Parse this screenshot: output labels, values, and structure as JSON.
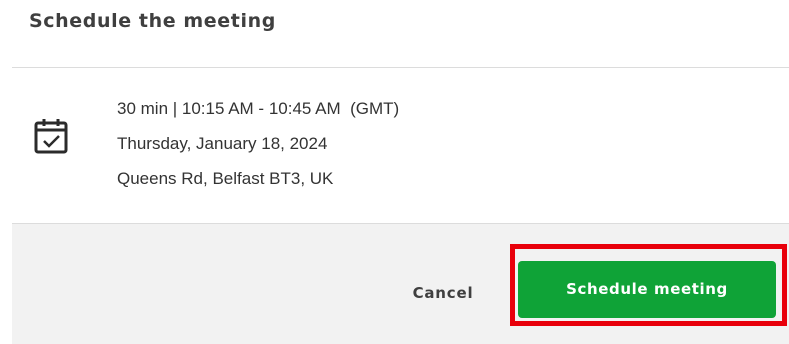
{
  "dialog": {
    "title": "Schedule the meeting"
  },
  "meeting": {
    "icon": "calendar-check-icon",
    "duration_time": "30 min | 10:15 AM - 10:45 AM  (GMT)",
    "date": "Thursday, January 18, 2024",
    "location": "Queens Rd, Belfast BT3, UK"
  },
  "actions": {
    "cancel_label": "Cancel",
    "schedule_label": "Schedule meeting"
  },
  "colors": {
    "primary_button": "#0fa337",
    "highlight_border": "#e8000b",
    "footer_bg": "#f2f2f2"
  }
}
